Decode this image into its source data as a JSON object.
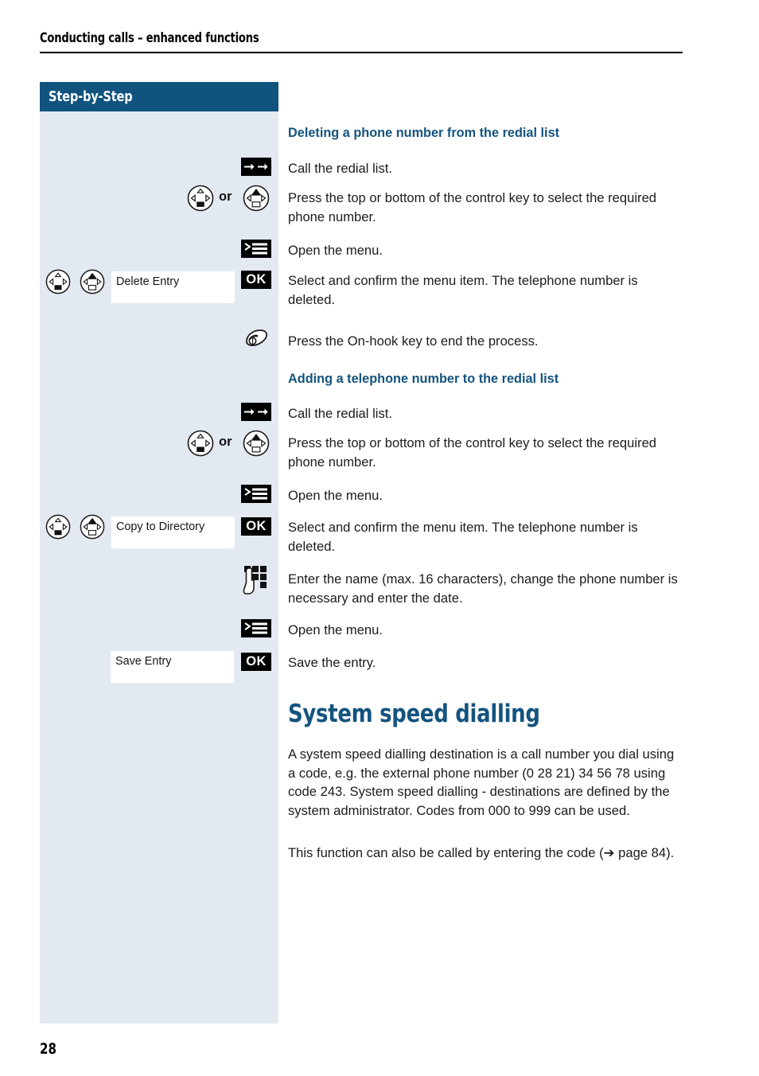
{
  "page": {
    "running_header": "Conducting calls – enhanced functions",
    "number": "28"
  },
  "sidebar": {
    "header_label": "Step-by-Step",
    "rows": [
      {
        "display_text": "Delete Entry",
        "ok_label": "OK"
      },
      {
        "display_text": "Copy to Directory",
        "ok_label": "OK"
      },
      {
        "display_text": "Save Entry",
        "ok_label": "OK"
      }
    ],
    "or_label": "or"
  },
  "content": {
    "section_1": {
      "heading": "Deleting a phone number from the redial list",
      "steps": [
        {
          "icon": "redial-icon",
          "text": "Call the redial list."
        },
        {
          "icon": "control-key-pair-icon",
          "text": "Press the top or bottom of the control key to select the required phone number."
        },
        {
          "icon": "menu-icon",
          "text": "Open the menu."
        },
        {
          "icon": "ok-key-icon",
          "text": "Select and confirm the menu item. The telephone number is deleted."
        },
        {
          "icon": "on-hook-key-icon",
          "text": "Press the On-hook key to end the process."
        }
      ]
    },
    "section_2": {
      "heading": "Adding a telephone number to the redial list",
      "steps": [
        {
          "icon": "redial-icon",
          "text": "Call the redial list."
        },
        {
          "icon": "control-key-pair-icon",
          "text": "Press the top or bottom of the control key to select the required phone number."
        },
        {
          "icon": "menu-icon",
          "text": "Open the menu."
        },
        {
          "icon": "ok-key-icon",
          "text": "Select and confirm the menu item. The telephone number is deleted."
        },
        {
          "icon": "keypad-icon",
          "text": "Enter the name (max. 16 characters), change the phone number is necessary and enter the date."
        },
        {
          "icon": "menu-icon",
          "text": "Open the menu."
        },
        {
          "icon": "ok-key-icon",
          "text": "Save the entry."
        }
      ]
    },
    "section_3": {
      "heading": "System speed dialling",
      "paragraph_1": "A system speed dialling destination is a call number you dial using a code, e.g. the external phone number (0 28 21) 34 56 78 using code 243. System speed dialling - destinations are defined by the system administrator. Codes from 000 to 999 can be used.",
      "paragraph_2_prefix": "This function can also be called by entering the code (",
      "paragraph_2_arrow": "➔",
      "paragraph_2_ref": " page 84).",
      "paragraph_2_full": "This function can also be called by entering the code (➔ page 84)."
    }
  },
  "colors": {
    "brand_blue": "#10537f",
    "heading_blue": "#14547f",
    "sidebar_bg": "#e3e9f1",
    "key_black": "#000000"
  }
}
